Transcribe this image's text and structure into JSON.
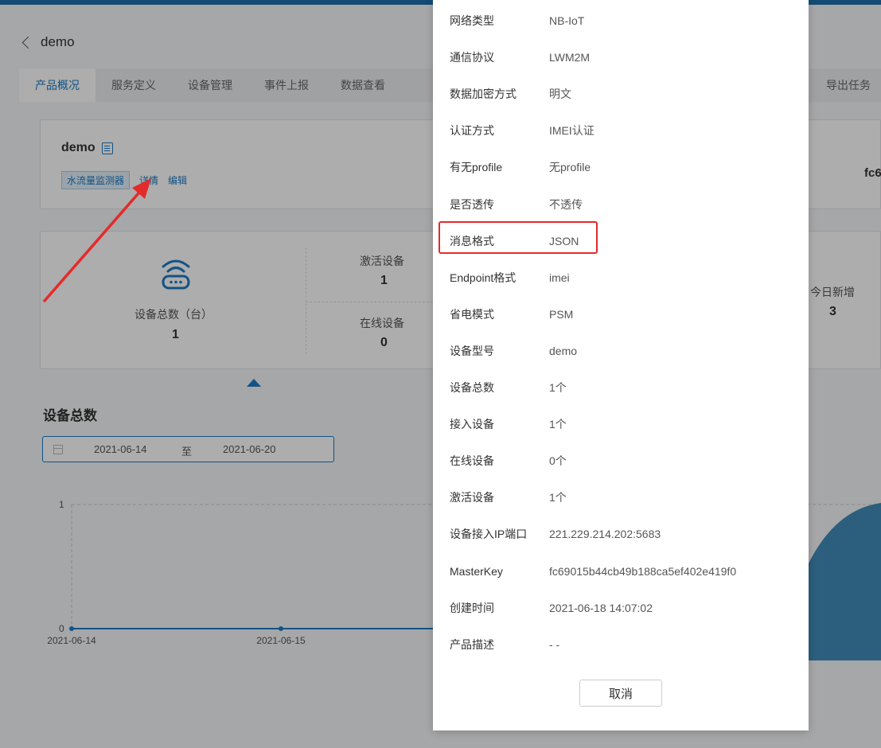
{
  "header": {
    "back_title": "demo"
  },
  "tabs": [
    {
      "label": "产品概况",
      "active": true
    },
    {
      "label": "服务定义"
    },
    {
      "label": "设备管理"
    },
    {
      "label": "事件上报"
    },
    {
      "label": "数据查看"
    },
    {
      "label": "导出任务"
    }
  ],
  "product": {
    "name": "demo",
    "tag": "水流量监测器",
    "detail_link": "详情",
    "edit_link": "编辑",
    "right_fragment": "fc6"
  },
  "stats": {
    "total_label": "设备总数（台）",
    "total_value": "1",
    "activated_label": "激活设备",
    "activated_value": "1",
    "online_label": "在线设备",
    "online_value": "0",
    "today_new_label": "今日新增",
    "today_new_value": "3"
  },
  "chart_section": {
    "title": "设备总数",
    "date_from": "2021-06-14",
    "date_sep": "至",
    "date_to": "2021-06-20"
  },
  "chart_data": {
    "type": "area",
    "x": [
      "2021-06-14",
      "2021-06-15"
    ],
    "y_ticks": [
      0,
      1
    ],
    "series": [
      {
        "values": [
          0,
          0
        ]
      }
    ],
    "color": "#1c7bc4"
  },
  "modal": {
    "rows": [
      {
        "key": "网络类型",
        "value": "NB-IoT"
      },
      {
        "key": "通信协议",
        "value": "LWM2M"
      },
      {
        "key": "数据加密方式",
        "value": "明文"
      },
      {
        "key": "认证方式",
        "value": "IMEI认证"
      },
      {
        "key": "有无profile",
        "value": "无profile"
      },
      {
        "key": "是否透传",
        "value": "不透传"
      },
      {
        "key": "消息格式",
        "value": "JSON"
      },
      {
        "key": "Endpoint格式",
        "value": "imei"
      },
      {
        "key": "省电模式",
        "value": "PSM"
      },
      {
        "key": "设备型号",
        "value": "demo"
      },
      {
        "key": "设备总数",
        "value": "1个"
      },
      {
        "key": "接入设备",
        "value": "1个"
      },
      {
        "key": "在线设备",
        "value": "0个"
      },
      {
        "key": "激活设备",
        "value": "1个"
      },
      {
        "key": "设备接入IP端口",
        "value": "221.229.214.202:5683"
      },
      {
        "key": "MasterKey",
        "value": "fc69015b44cb49b188ca5ef402e419f0"
      },
      {
        "key": "创建时间",
        "value": "2021-06-18 14:07:02"
      },
      {
        "key": "产品描述",
        "value": "- -"
      }
    ],
    "cancel_label": "取消"
  },
  "colors": {
    "accent": "#1c7bc4",
    "highlight": "#e32b2b",
    "topbar": "#1f6fa8"
  }
}
